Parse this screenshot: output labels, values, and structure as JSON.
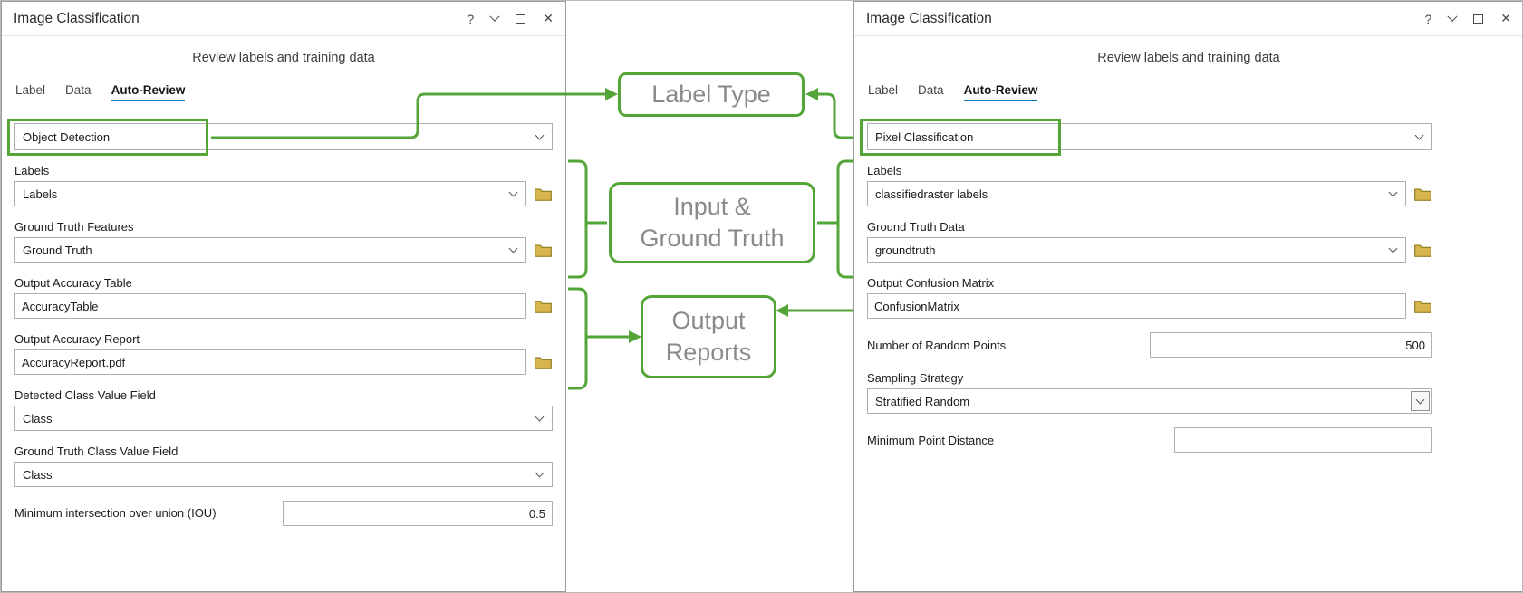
{
  "window": {
    "help_icon": "?",
    "close_icon": "✕"
  },
  "left_panel": {
    "title": "Image Classification",
    "subtitle": "Review labels and training data",
    "tabs": {
      "label": "Label",
      "data": "Data",
      "auto_review": "Auto-Review"
    },
    "label_type": {
      "value": "Object Detection"
    },
    "labels": {
      "label": "Labels",
      "value": "Labels"
    },
    "ground_truth": {
      "label": "Ground Truth Features",
      "value": "Ground Truth"
    },
    "accuracy_table": {
      "label": "Output Accuracy Table",
      "value": "AccuracyTable"
    },
    "accuracy_report": {
      "label": "Output Accuracy Report",
      "value": "AccuracyReport.pdf"
    },
    "detected_class": {
      "label": "Detected Class Value Field",
      "value": "Class"
    },
    "gt_class": {
      "label": "Ground Truth Class Value Field",
      "value": "Class"
    },
    "iou": {
      "label": "Minimum intersection over union (IOU)",
      "value": "0.5"
    }
  },
  "right_panel": {
    "title": "Image Classification",
    "subtitle": "Review labels and training data",
    "tabs": {
      "label": "Label",
      "data": "Data",
      "auto_review": "Auto-Review"
    },
    "label_type": {
      "value": "Pixel Classification"
    },
    "labels": {
      "label": "Labels",
      "value": "classifiedraster labels"
    },
    "ground_truth": {
      "label": "Ground Truth Data",
      "value": "groundtruth"
    },
    "confusion_matrix": {
      "label": "Output Confusion Matrix",
      "value": "ConfusionMatrix"
    },
    "random_points": {
      "label": "Number of Random Points",
      "value": "500"
    },
    "sampling": {
      "label": "Sampling Strategy",
      "value": "Stratified Random"
    },
    "min_distance": {
      "label": "Minimum Point Distance",
      "value": ""
    }
  },
  "annotations": {
    "label_type": "Label Type",
    "input_ground_truth_line1": "Input &",
    "input_ground_truth_line2": "Ground Truth",
    "output_reports_line1": "Output",
    "output_reports_line2": "Reports",
    "green": "#54a538",
    "text_color": "#8a8a8a"
  }
}
